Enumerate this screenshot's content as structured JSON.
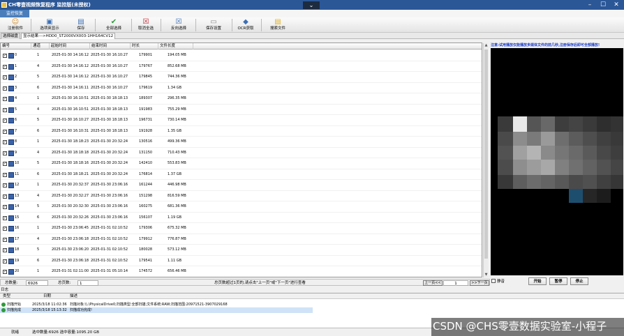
{
  "window": {
    "title": "CH零壹视频恢复程序 监控版(未授权)",
    "collapse_glyph": "⌄",
    "minimize": "–",
    "restore": "☐",
    "close": "✕"
  },
  "menu": {
    "active_tab": "监控恢复"
  },
  "toolbar": {
    "items": [
      {
        "label": "注册软件",
        "icon": "user-key-icon",
        "glyph": "☺",
        "color": "#d08a28"
      },
      {
        "label": "选项英显示",
        "icon": "monitor-icon",
        "glyph": "▣",
        "color": "#3b6fb6"
      },
      {
        "label": "保存",
        "icon": "save-icon",
        "glyph": "▤",
        "color": "#3b6fb6"
      },
      {
        "label": "全部选择",
        "icon": "check-all-icon",
        "glyph": "✔",
        "color": "#2e9b3a"
      },
      {
        "label": "取消全选",
        "icon": "uncheck-all-icon",
        "glyph": "☒",
        "color": "#c0202a"
      },
      {
        "label": "反向选择",
        "icon": "invert-selection-icon",
        "glyph": "☒",
        "color": "#3b6fb6"
      },
      {
        "label": "保存设置",
        "icon": "settings-save-icon",
        "glyph": "▭",
        "color": "#888888"
      },
      {
        "label": "OCR获取",
        "icon": "ocr-icon",
        "glyph": "◆",
        "color": "#3b6fb6"
      },
      {
        "label": "搜索文件",
        "icon": "search-file-icon",
        "glyph": "▤",
        "color": "#e0b020"
      }
    ]
  },
  "tabs": {
    "scan_drive": "选择磁盘",
    "results": "显示结果--->HDD0_ST2000VX003-1HH164CV12"
  },
  "grid": {
    "columns": [
      "编号",
      "通道",
      "起始时间",
      "结束时间",
      "时长",
      "文件长度"
    ],
    "rows": [
      [
        "0",
        "1",
        "2025-01-30 14:16:12",
        "2025-01-30 16:10:27",
        "179901",
        "194.05 MB"
      ],
      [
        "1",
        "4",
        "2025-01-30 14:16:12",
        "2025-01-30 16:10:27",
        "179767",
        "852.68 MB"
      ],
      [
        "2",
        "5",
        "2025-01-30 14:16:12",
        "2025-01-30 16:10:27",
        "179845",
        "744.36 MB"
      ],
      [
        "3",
        "6",
        "2025-01-30 14:16:11",
        "2025-01-30 16:10:27",
        "179619",
        "1.34 GB"
      ],
      [
        "4",
        "1",
        "2025-01-30 16:10:51",
        "2025-01-30 18:18:13",
        "189307",
        "296.35 MB"
      ],
      [
        "5",
        "4",
        "2025-01-30 16:10:51",
        "2025-01-30 18:18:13",
        "191983",
        "755.29 MB"
      ],
      [
        "6",
        "5",
        "2025-01-30 16:10:27",
        "2025-01-30 18:18:13",
        "196731",
        "730.14 MB"
      ],
      [
        "7",
        "6",
        "2025-01-30 16:10:31",
        "2025-01-30 18:18:13",
        "191928",
        "1.35 GB"
      ],
      [
        "8",
        "1",
        "2025-01-30 18:18:23",
        "2025-01-30 20:32:24",
        "130516",
        "499.36 MB"
      ],
      [
        "9",
        "4",
        "2025-01-30 18:18:18",
        "2025-01-30 20:32:24",
        "131150",
        "710.43 MB"
      ],
      [
        "10",
        "5",
        "2025-01-30 18:18:16",
        "2025-01-30 20:32:24",
        "142410",
        "553.83 MB"
      ],
      [
        "11",
        "6",
        "2025-01-30 18:18:21",
        "2025-01-30 20:32:24",
        "176814",
        "1.37 GB"
      ],
      [
        "12",
        "1",
        "2025-01-30 20:32:37",
        "2025-01-30 23:06:16",
        "161244",
        "446.98 MB"
      ],
      [
        "13",
        "4",
        "2025-01-30 20:32:27",
        "2025-01-30 23:06:16",
        "151298",
        "816.59 MB"
      ],
      [
        "14",
        "5",
        "2025-01-30 20:32:30",
        "2025-01-30 23:06:16",
        "160275",
        "681.36 MB"
      ],
      [
        "15",
        "6",
        "2025-01-30 20:32:26",
        "2025-01-30 23:06:16",
        "156107",
        "1.19 GB"
      ],
      [
        "16",
        "1",
        "2025-01-30 23:06:45",
        "2025-01-31 02:10:52",
        "179306",
        "675.32 MB"
      ],
      [
        "17",
        "4",
        "2025-01-30 23:06:18",
        "2025-01-31 02:10:52",
        "179912",
        "776.87 MB"
      ],
      [
        "18",
        "5",
        "2025-01-30 23:06:20",
        "2025-01-31 02:10:52",
        "180028",
        "573.12 MB"
      ],
      [
        "19",
        "6",
        "2025-01-30 23:06:18",
        "2025-01-31 02:10:52",
        "179541",
        "1.11 GB"
      ],
      [
        "20",
        "1",
        "2025-01-31 02:11:00",
        "2025-01-31 05:10:14",
        "174572",
        "656.46 MB"
      ]
    ]
  },
  "pager": {
    "total_label": "总数量:",
    "total": "6926",
    "pages_label": "总页数:",
    "pages": "1",
    "hint": "总页数超过1页的,请点击\"上一页\"或\"下一页\"进行查看",
    "prev": "上一页<<",
    "page": "1",
    "next": ">>下一页"
  },
  "preview": {
    "note": "注意:试用播放仅能播放多媒体文件的前几秒,注册保存后即可全部播放!"
  },
  "controls": {
    "mute": "静音",
    "start": "开始",
    "pause": "暂停",
    "stop": "停止"
  },
  "log": {
    "title": "日志",
    "columns": [
      "类型",
      "日期",
      "描述"
    ],
    "rows": [
      {
        "type": "扫描开始",
        "date": "2025/3/18 11:02:36",
        "desc": "扫描对象:\\\\.\\PhysicalDrive0;扫描类型:全部扫描;文件系统:RAW;扫描范围:20971521-3907029168"
      },
      {
        "type": "扫描完成",
        "date": "2025/3/18 15:13:32",
        "desc": "扫描成功完成!"
      }
    ]
  },
  "status": {
    "ready": "就绪",
    "selection": "选中数量:6926 选中容量:1095.20 GB"
  },
  "watermark": {
    "text": "CSDN @CHS零壹数据实验室-小程子"
  }
}
